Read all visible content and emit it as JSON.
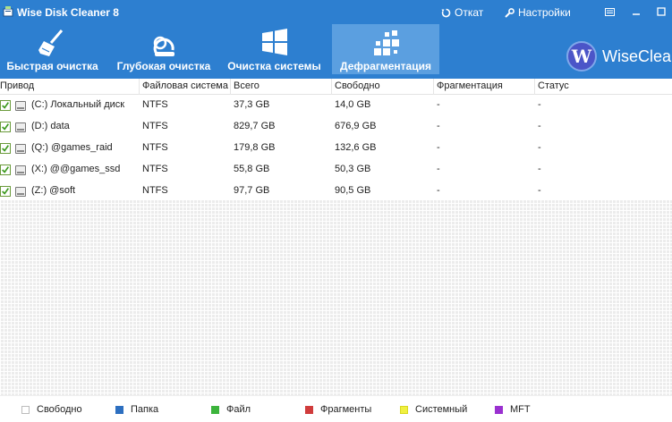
{
  "app": {
    "title": "Wise Disk Cleaner 8"
  },
  "titlebar": {
    "rollback_label": "Откат",
    "settings_label": "Настройки"
  },
  "nav": {
    "tabs": [
      {
        "label": "Быстрая очистка",
        "icon": "broom-icon"
      },
      {
        "label": "Глубокая очистка",
        "icon": "vacuum-icon"
      },
      {
        "label": "Очистка системы",
        "icon": "windows-icon"
      },
      {
        "label": "Дефрагментация",
        "icon": "defrag-icon",
        "active": true
      }
    ]
  },
  "brand": {
    "logo_letter": "W",
    "name": "WiseClean"
  },
  "table": {
    "headers": [
      "Привод",
      "Файловая система",
      "Всего",
      "Свободно",
      "Фрагментация",
      "Статус"
    ],
    "rows": [
      {
        "drive": "(C:) Локальный диск",
        "fs": "NTFS",
        "total": "37,3 GB",
        "free": "14,0 GB",
        "frag": "-",
        "status": "-",
        "checked": true
      },
      {
        "drive": "(D:) data",
        "fs": "NTFS",
        "total": "829,7 GB",
        "free": "676,9 GB",
        "frag": "-",
        "status": "-",
        "checked": true
      },
      {
        "drive": "(Q:) @games_raid",
        "fs": "NTFS",
        "total": "179,8 GB",
        "free": "132,6 GB",
        "frag": "-",
        "status": "-",
        "checked": true
      },
      {
        "drive": "(X:) @@games_ssd",
        "fs": "NTFS",
        "total": "55,8 GB",
        "free": "50,3 GB",
        "frag": "-",
        "status": "-",
        "checked": true
      },
      {
        "drive": "(Z:) @soft",
        "fs": "NTFS",
        "total": "97,7 GB",
        "free": "90,5 GB",
        "frag": "-",
        "status": "-",
        "checked": true
      }
    ]
  },
  "legend": [
    {
      "label": "Свободно",
      "color": "#ffffff"
    },
    {
      "label": "Папка",
      "color": "#2d6fc0"
    },
    {
      "label": "Файл",
      "color": "#3cb43c"
    },
    {
      "label": "Фрагменты",
      "color": "#d03c3c"
    },
    {
      "label": "Системный",
      "color": "#f0f040"
    },
    {
      "label": "MFT",
      "color": "#9a30d0"
    }
  ],
  "colors": {
    "accent": "#2d7fd0",
    "active_tab": "#5b9fe0"
  }
}
